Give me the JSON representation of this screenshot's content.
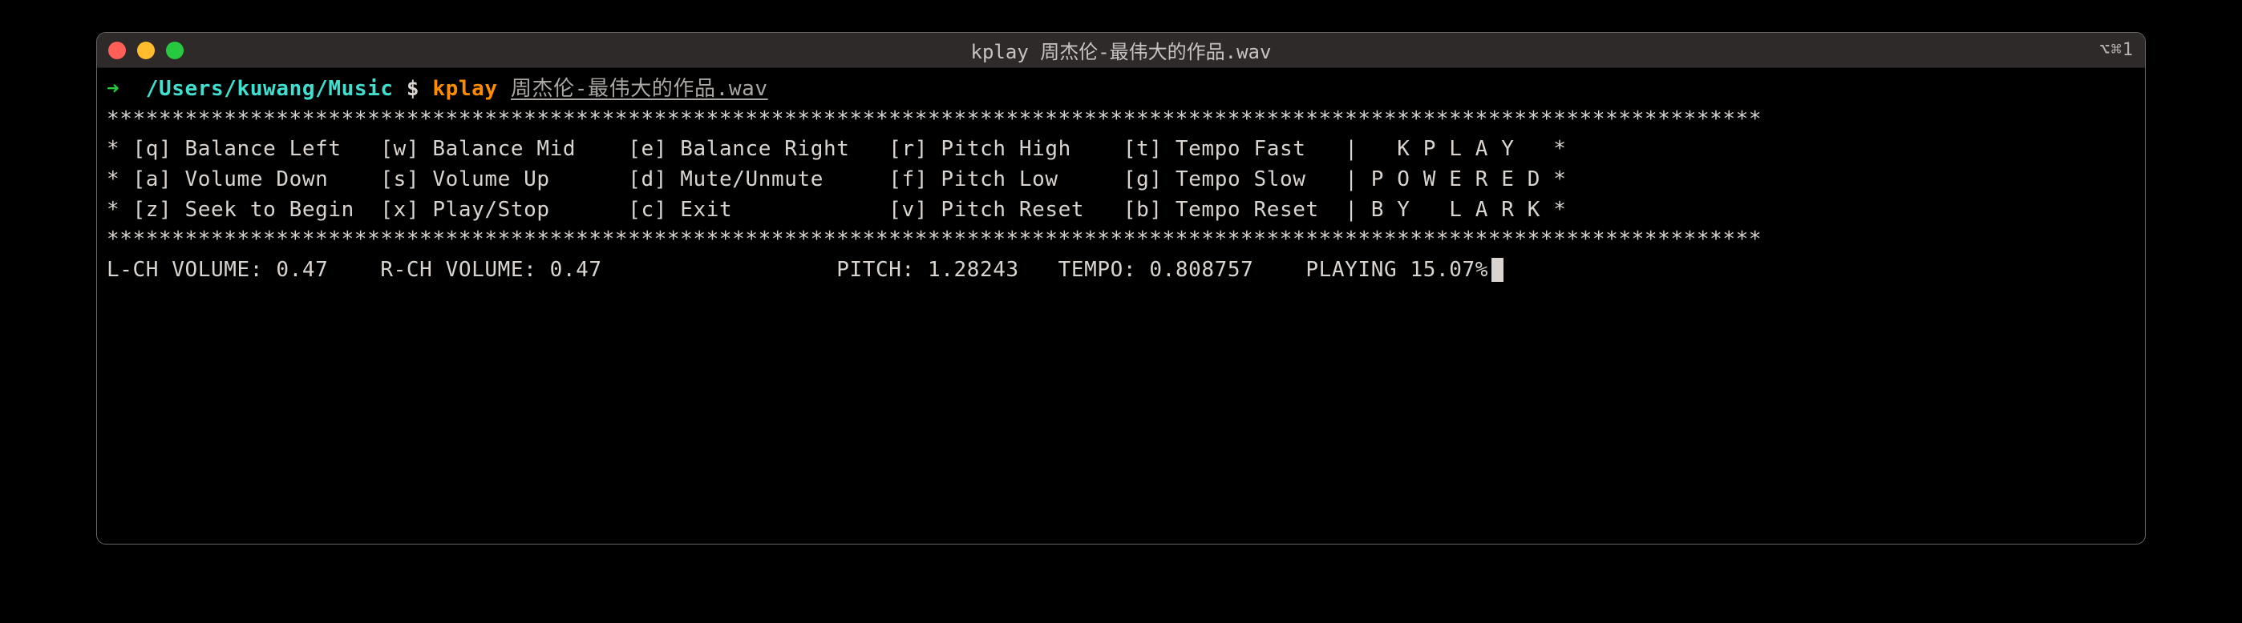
{
  "titlebar": {
    "title": "kplay 周杰伦-最伟大的作品.wav",
    "right": "⌥⌘1"
  },
  "prompt": {
    "arrow": "➜",
    "path": "/Users/kuwang/Music",
    "dollar": "$",
    "command": "kplay",
    "argument": "周杰伦-最伟大的作品.wav"
  },
  "keys": {
    "q": {
      "k": "[q]",
      "label": "Balance Left"
    },
    "w": {
      "k": "[w]",
      "label": "Balance Mid"
    },
    "e": {
      "k": "[e]",
      "label": "Balance Right"
    },
    "r": {
      "k": "[r]",
      "label": "Pitch High"
    },
    "t": {
      "k": "[t]",
      "label": "Tempo Fast"
    },
    "a": {
      "k": "[a]",
      "label": "Volume Down"
    },
    "s": {
      "k": "[s]",
      "label": "Volume Up"
    },
    "d": {
      "k": "[d]",
      "label": "Mute/Unmute"
    },
    "f": {
      "k": "[f]",
      "label": "Pitch Low"
    },
    "g": {
      "k": "[g]",
      "label": "Tempo Slow"
    },
    "z": {
      "k": "[z]",
      "label": "Seek to Begin"
    },
    "x": {
      "k": "[x]",
      "label": "Play/Stop"
    },
    "c": {
      "k": "[c]",
      "label": "Exit"
    },
    "v": {
      "k": "[v]",
      "label": "Pitch Reset"
    },
    "b": {
      "k": "[b]",
      "label": "Tempo Reset"
    }
  },
  "brand": {
    "line1": "|   K P L A Y   *",
    "line2": "| P O W E R E D *",
    "line3": "| B Y   L A R K *"
  },
  "status": {
    "lch_label": "L-CH VOLUME:",
    "lch_value": "0.47",
    "rch_label": "R-CH VOLUME:",
    "rch_value": "0.47",
    "pitch_label": "PITCH:",
    "pitch_value": "1.28243",
    "tempo_label": "TEMPO:",
    "tempo_value": "0.808757",
    "playing_label": "PLAYING",
    "playing_value": "15.07%"
  },
  "divider": "*******************************************************************************************************************************"
}
